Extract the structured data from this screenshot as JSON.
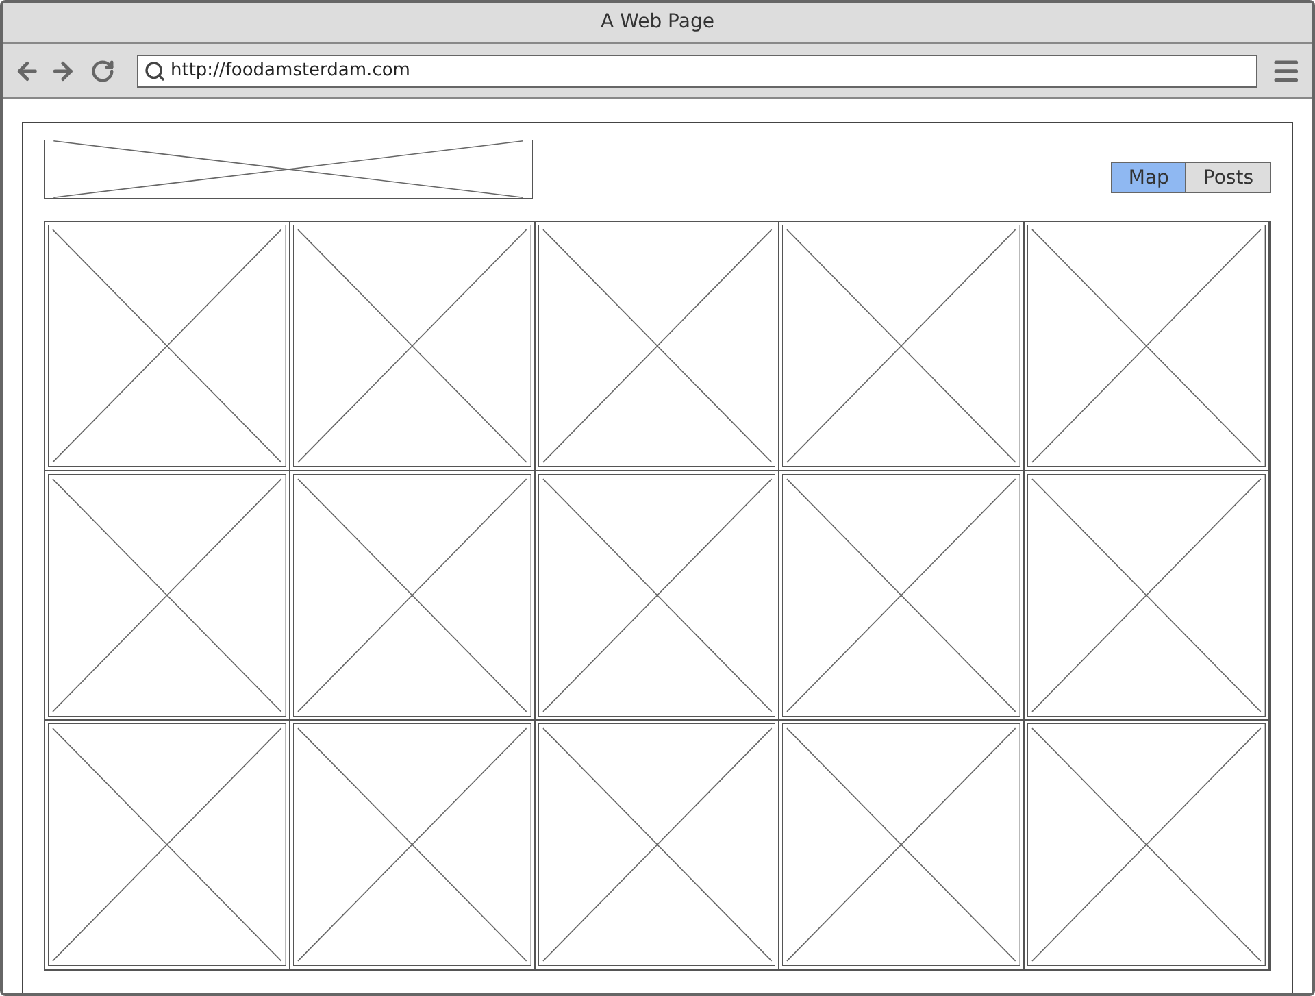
{
  "window": {
    "title": "A Web Page"
  },
  "address_bar": {
    "value": "http://foodamsterdam.com"
  },
  "logo": {
    "kind": "image"
  },
  "tabs": [
    {
      "label": "Map",
      "selected": true
    },
    {
      "label": "Posts",
      "selected": false
    }
  ],
  "grid": [
    {
      "kind": "image"
    },
    {
      "kind": "image"
    },
    {
      "kind": "image"
    },
    {
      "kind": "image"
    },
    {
      "kind": "image"
    },
    {
      "kind": "image"
    },
    {
      "kind": "image"
    },
    {
      "kind": "image"
    },
    {
      "kind": "image"
    },
    {
      "kind": "image"
    },
    {
      "kind": "image"
    },
    {
      "kind": "image"
    },
    {
      "kind": "image"
    },
    {
      "kind": "image"
    },
    {
      "kind": "image"
    }
  ]
}
